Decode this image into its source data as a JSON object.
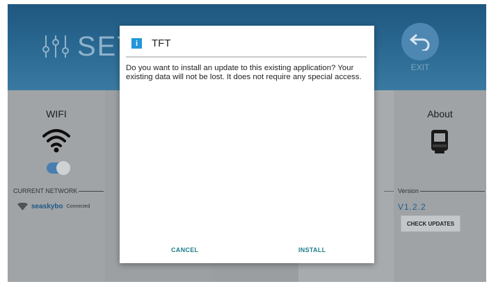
{
  "header": {
    "title_fragment": "SET",
    "exit_label": "EXIT"
  },
  "wifi_panel": {
    "title": "WIFI",
    "toggle_on": true,
    "current_network_label": "CURRENT NETWORK",
    "network_name": "seaskybo",
    "network_status": "Connected"
  },
  "about_panel": {
    "title": "About",
    "version_label": "Version",
    "version_value": "V1.2.2",
    "check_updates_label": "CHECK UPDATES"
  },
  "dialog": {
    "title": "TFT",
    "info_icon_text": "i",
    "message": "Do you want to install an update to this existing application? Your existing data will not be lost. It does not require any special access.",
    "cancel_label": "CANCEL",
    "install_label": "INSTALL"
  },
  "colors": {
    "accent": "#2196d8",
    "button_text": "#1e7d8a",
    "header": "#2b6a93"
  }
}
